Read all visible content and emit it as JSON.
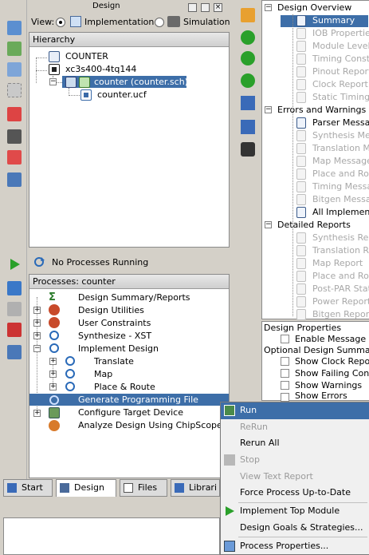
{
  "design_panel": {
    "title": "Design",
    "view_label": "View:",
    "view_implementation": "Implementation",
    "view_simulation": "Simulation",
    "hierarchy_header": "Hierarchy",
    "hierarchy": [
      {
        "label": "COUNTER",
        "icon": "project-icon"
      },
      {
        "label": "xc3s400-4tq144",
        "icon": "chip-icon"
      },
      {
        "label": "counter (counter.sch)",
        "icon": "schematic-icon",
        "selected": true
      },
      {
        "label": "counter.ucf",
        "icon": "ucf-file-icon"
      }
    ],
    "status_text": "No Processes Running",
    "processes_header": "Processes: counter",
    "processes": [
      {
        "label": "Design Summary/Reports"
      },
      {
        "label": "Design Utilities"
      },
      {
        "label": "User Constraints"
      },
      {
        "label": "Synthesize - XST"
      },
      {
        "label": "Implement Design"
      },
      {
        "label": "Translate"
      },
      {
        "label": "Map"
      },
      {
        "label": "Place & Route"
      },
      {
        "label": "Generate Programming File",
        "selected": true
      },
      {
        "label": "Configure Target Device"
      },
      {
        "label": "Analyze Design Using ChipScope"
      }
    ],
    "tabs": [
      "Start",
      "Design",
      "Files",
      "Librari"
    ]
  },
  "design_overview": {
    "items": [
      {
        "label": "Design Overview",
        "type": "folder"
      },
      {
        "label": "Summary",
        "type": "doc",
        "selected": true
      },
      {
        "label": "IOB Properties",
        "type": "doc",
        "disabled": true
      },
      {
        "label": "Module Level",
        "type": "doc",
        "disabled": true
      },
      {
        "label": "Timing Constr",
        "type": "doc",
        "disabled": true
      },
      {
        "label": "Pinout Report",
        "type": "doc",
        "disabled": true
      },
      {
        "label": "Clock Report",
        "type": "doc",
        "disabled": true
      },
      {
        "label": "Static Timing",
        "type": "doc",
        "disabled": true
      },
      {
        "label": "Errors and Warnings",
        "type": "folder"
      },
      {
        "label": "Parser Messa",
        "type": "doc"
      },
      {
        "label": "Synthesis Me",
        "type": "doc",
        "disabled": true
      },
      {
        "label": "Translation M",
        "type": "doc",
        "disabled": true
      },
      {
        "label": "Map Message",
        "type": "doc",
        "disabled": true
      },
      {
        "label": "Place and Ro",
        "type": "doc",
        "disabled": true
      },
      {
        "label": "Timing Messa",
        "type": "doc",
        "disabled": true
      },
      {
        "label": "Bitgen Messa",
        "type": "doc",
        "disabled": true
      },
      {
        "label": "All Implemen",
        "type": "doc"
      },
      {
        "label": "Detailed Reports",
        "type": "folder"
      },
      {
        "label": "Synthesis Rep",
        "type": "doc",
        "disabled": true
      },
      {
        "label": "Translation Re",
        "type": "doc",
        "disabled": true
      },
      {
        "label": "Map Report",
        "type": "doc",
        "disabled": true
      },
      {
        "label": "Place and Ro",
        "type": "doc",
        "disabled": true
      },
      {
        "label": "Post-PAR Stati",
        "type": "doc",
        "disabled": true
      },
      {
        "label": "Power Report",
        "type": "doc",
        "disabled": true
      },
      {
        "label": "Bitgen Report",
        "type": "doc",
        "disabled": true
      }
    ]
  },
  "design_properties": {
    "title": "Design Properties",
    "enable_message": "Enable Message F",
    "optional_title": "Optional Design Summa",
    "options": [
      "Show Clock Repo",
      "Show Failing Con",
      "Show Warnings",
      "Show Errors"
    ]
  },
  "context_menu": {
    "items": [
      {
        "label": "Run",
        "enabled": true,
        "highlighted": true,
        "icon": "run-icon"
      },
      {
        "label": "ReRun",
        "enabled": false
      },
      {
        "label": "Rerun All",
        "enabled": true
      },
      {
        "label": "Stop",
        "enabled": false,
        "icon": "stop-icon"
      },
      {
        "label": "View Text Report",
        "enabled": false
      },
      {
        "label": "Force Process Up-to-Date",
        "enabled": true
      },
      {
        "label": "Implement Top Module",
        "enabled": true,
        "icon": "green-arrow-icon"
      },
      {
        "label": "Design Goals & Strategies...",
        "enabled": true
      },
      {
        "label": "Process Properties...",
        "enabled": true,
        "icon": "properties-icon"
      }
    ]
  },
  "colors": {
    "selection": "#3d6ea8",
    "panel_bg": "#d4d0c8",
    "menu_highlight": "#3d6ea8"
  }
}
